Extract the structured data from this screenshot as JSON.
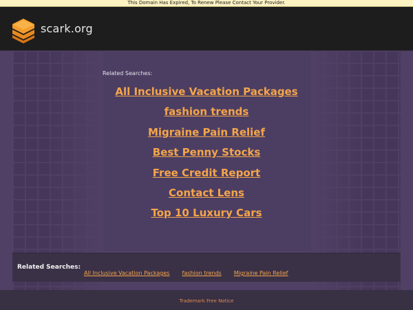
{
  "notice": "This Domain Has Expired, To Renew Please Contact Your Provider.",
  "header": {
    "site_name": "scark.org",
    "logo_icon": "stacked-layers-icon"
  },
  "main": {
    "related_heading": "Related Searches:",
    "links": [
      "All Inclusive Vacation Packages",
      "fashion trends",
      "Migraine Pain Relief",
      "Best Penny Stocks",
      "Free Credit Report",
      "Contact Lens",
      "Top 10 Luxury Cars"
    ]
  },
  "bottom": {
    "label": "Related Searches:",
    "links": [
      "All Inclusive Vacation Packages",
      "fashion trends",
      "Migraine Pain Relief"
    ]
  },
  "footer": {
    "trademark": "Trademark Free Notice"
  },
  "colors": {
    "accent": "#f4a54a",
    "background": "#514066",
    "header": "#1d1d1d"
  }
}
